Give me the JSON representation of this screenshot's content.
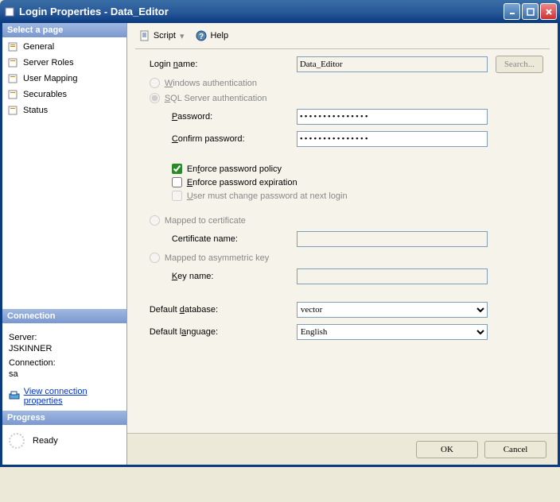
{
  "titlebar": {
    "title": "Login Properties - Data_Editor"
  },
  "sidebar": {
    "select_page_header": "Select a page",
    "pages": [
      {
        "label": "General"
      },
      {
        "label": "Server Roles"
      },
      {
        "label": "User Mapping"
      },
      {
        "label": "Securables"
      },
      {
        "label": "Status"
      }
    ],
    "connection_header": "Connection",
    "server_label": "Server:",
    "server_value": "JSKINNER",
    "connection_label": "Connection:",
    "connection_value": "sa",
    "view_conn_props": "View connection properties",
    "progress_header": "Progress",
    "progress_status": "Ready"
  },
  "toolbar": {
    "script": "Script",
    "dropdown": "▾",
    "help": "Help"
  },
  "form": {
    "login_name_label": "Login name:",
    "login_name_value": "Data_Editor",
    "search_btn": "Search...",
    "windows_auth": "Windows authentication",
    "sql_auth": "SQL Server authentication",
    "password_label": "Password:",
    "password_value": "●●●●●●●●●●●●●●●",
    "confirm_label": "Confirm password:",
    "confirm_value": "●●●●●●●●●●●●●●●",
    "enforce_policy": "Enforce password policy",
    "enforce_expiration": "Enforce password expiration",
    "must_change": "User must change password at next login",
    "mapped_cert": "Mapped to certificate",
    "cert_name_label": "Certificate name:",
    "mapped_asym": "Mapped to asymmetric key",
    "key_name_label": "Key name:",
    "default_db_label": "Default database:",
    "default_db_value": "vector",
    "default_lang_label": "Default language:",
    "default_lang_value": "English"
  },
  "buttons": {
    "ok": "OK",
    "cancel": "Cancel"
  }
}
